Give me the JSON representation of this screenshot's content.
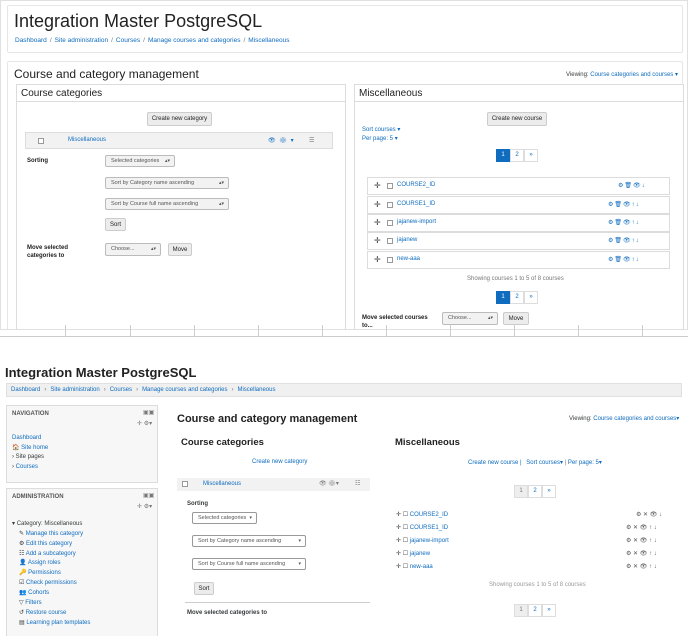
{
  "site_name": "Integration Master PostgreSQL",
  "breadcrumb": [
    "Dashboard",
    "Site administration",
    "Courses",
    "Manage courses and categories",
    "Miscellaneous"
  ],
  "breadcrumb_sep": "/",
  "page_title": "Course and category management",
  "viewing": {
    "label": "Viewing:",
    "value": "Course categories and courses"
  },
  "left": {
    "heading": "Course categories",
    "create_button": "Create new category",
    "category_name": "Miscellaneous",
    "sorting_label": "Sorting",
    "sorting_select": "Selected categories",
    "sort_by_name": "Sort by Category name ascending",
    "sort_by_course": "Sort by Course full name ascending",
    "sort_button": "Sort",
    "move_label": "Move selected categories to",
    "move_select": "Choose...",
    "move_button": "Move"
  },
  "right": {
    "heading": "Miscellaneous",
    "create_button": "Create new course",
    "sort_courses": "Sort courses",
    "per_page": "Per page: 5",
    "pages": [
      "1",
      "2",
      "»"
    ],
    "courses": [
      "COURSE2_ID",
      "COURSE1_ID",
      "jajanew-import",
      "jajanew",
      "new-aaa"
    ],
    "showing": "Showing courses 1 to 5 of 8 courses",
    "move_label": "Move selected courses to...",
    "move_select": "Choose...",
    "move_button": "Move"
  },
  "bottom": {
    "site_name": "Integration Master PostgreSQL",
    "nav_block": {
      "title": "NAVIGATION",
      "items": [
        "Dashboard",
        "Site home",
        "Site pages",
        "Courses"
      ]
    },
    "admin_block": {
      "title": "ADMINISTRATION",
      "items": [
        "Category: Miscellaneous",
        "Manage this category",
        "Edit this category",
        "Add a subcategory",
        "Assign roles",
        "Permissions",
        "Check permissions",
        "Cohorts",
        "Filters",
        "Restore course",
        "Learning plan templates"
      ]
    },
    "create_category_link": "Create new category",
    "create_course_link": "Create new course |",
    "sort_courses_link": "Sort courses",
    "per_page_link": "Per page: 5",
    "move_categories_label": "Move selected categories to"
  },
  "colors": {
    "link": "#0f6cbf",
    "active_page": "#0f6cbf"
  }
}
